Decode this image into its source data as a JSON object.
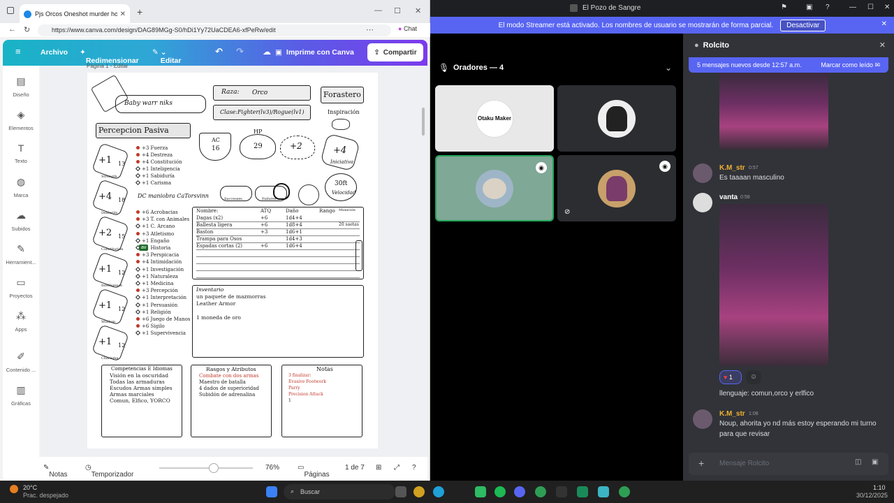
{
  "browser": {
    "tab_title": "Pjs Orcos Oneshot murder hobo ·",
    "url": "https://www.canva.com/design/DAG89MGg-S0/hDi1Yy72UaCDEA6-xfPeRw/edit",
    "chat_label": "Chat"
  },
  "canva": {
    "menu": {
      "archivo": "Archivo",
      "redimensionar": "Redimensionar",
      "editar": "Editar"
    },
    "print_label": "Imprime con Canva",
    "share_label": "Compartir",
    "page_header": "Página 1 - Editar",
    "sidebar": [
      {
        "label": "Diseño",
        "icon": "layout-icon"
      },
      {
        "label": "Elementos",
        "icon": "shapes-icon"
      },
      {
        "label": "Texto",
        "icon": "text-icon"
      },
      {
        "label": "Marca",
        "icon": "brand-icon"
      },
      {
        "label": "Subidos",
        "icon": "upload-icon"
      },
      {
        "label": "Herramient...",
        "icon": "tools-icon"
      },
      {
        "label": "Proyectos",
        "icon": "folder-icon"
      },
      {
        "label": "Apps",
        "icon": "apps-icon"
      },
      {
        "label": "Contenido ...",
        "icon": "content-icon"
      },
      {
        "label": "Gráficas",
        "icon": "chart-icon"
      }
    ],
    "bottom": {
      "notes": "Notas",
      "timer": "Temporizador",
      "zoom": "76%",
      "pages_label": "Páginas",
      "page_count": "1 de 7",
      "zoom_value": 76
    }
  },
  "sheet": {
    "name": "Baby warr niks",
    "race_label": "Raza:",
    "race": "Orco",
    "class": "Clase:Fighter(lv3)/Rogue(lv1)",
    "background": "Forastero",
    "inspiration": "Inspiración",
    "passive": "Percepcion Pasiva",
    "ac_label": "AC",
    "ac": "16",
    "hp_label": "HP",
    "hp": "29",
    "bonus": "+2",
    "initiative": "+4",
    "initiative_label": "Iniciativa",
    "speed": "30ft",
    "speed_label": "Velocidad",
    "dc_maneuver": "DC maniobra CaTorsvinn",
    "successes": "Successes",
    "failures": "Failures",
    "abilities": [
      {
        "mod": "+1",
        "score": "13",
        "name": "Strength"
      },
      {
        "mod": "+4",
        "score": "18",
        "name": "Dexterity"
      },
      {
        "mod": "+2",
        "score": "15",
        "name": "Constitution"
      },
      {
        "mod": "+1",
        "score": "12",
        "name": "Intelligence"
      },
      {
        "mod": "+1",
        "score": "12",
        "name": "Wisdom"
      },
      {
        "mod": "+1",
        "score": "12",
        "name": "Charisma"
      }
    ],
    "saves": [
      {
        "val": "+3",
        "name": "Fuerza"
      },
      {
        "val": "+4",
        "name": "Destreza"
      },
      {
        "val": "+4",
        "name": "Constitución"
      },
      {
        "val": "+1",
        "name": "Inteligencia"
      },
      {
        "val": "+1",
        "name": "Sabiduría"
      },
      {
        "val": "+1",
        "name": "Carisma"
      }
    ],
    "skills": [
      {
        "val": "+6",
        "name": "Acrobacias"
      },
      {
        "val": "+3",
        "name": "T. con Animales"
      },
      {
        "val": "+1",
        "name": "C. Arcano"
      },
      {
        "val": "+3",
        "name": "Atletismo"
      },
      {
        "val": "+1",
        "name": "Engaño"
      },
      {
        "val": "+1",
        "name": "Historia"
      },
      {
        "val": "+3",
        "name": "Perspicacia"
      },
      {
        "val": "+4",
        "name": "Intimidación"
      },
      {
        "val": "+1",
        "name": "Investigación"
      },
      {
        "val": "+1",
        "name": "Naturaleza"
      },
      {
        "val": "+1",
        "name": "Medicina"
      },
      {
        "val": "+3",
        "name": "Percepción"
      },
      {
        "val": "+1",
        "name": "Interpretación"
      },
      {
        "val": "+1",
        "name": "Persuasión"
      },
      {
        "val": "+1",
        "name": "Religión"
      },
      {
        "val": "+6",
        "name": "Juego de Manos"
      },
      {
        "val": "+6",
        "name": "Sigilo"
      },
      {
        "val": "+1",
        "name": "Supervivencia"
      }
    ],
    "av_badge": "av",
    "attacks_headers": [
      "Nombre:",
      "ATQ",
      "Daño",
      "Rango",
      "Munición"
    ],
    "attacks": [
      [
        "Dagas (x2)",
        "+6",
        "1d4+4",
        "",
        ""
      ],
      [
        "Ballesta ligera",
        "+6",
        "1d8+4",
        "",
        "20 saetas"
      ],
      [
        "Baston",
        "+3",
        "1d6+1",
        "",
        ""
      ],
      [
        "Trampa para Osos",
        "",
        "1d4+3",
        "",
        ""
      ],
      [
        "Espadas cortas (2)",
        "+6",
        "1d6+4",
        "",
        ""
      ]
    ],
    "inventory_title": "Inventario",
    "inventory": [
      "un paquete de mazmorras",
      "Leather Armor",
      "",
      "1 moneda de oro"
    ],
    "prof_title": "Competencias E Idiomas",
    "prof": [
      "Visión en la oscuridad",
      "Todas las armaduras",
      "Escudos   Armas simples",
      "Armas marciales",
      "Comun, Elfico, YORCO"
    ],
    "traits_title": "Rasgos y Atributos",
    "traits": [
      "Combate con dos armas",
      "Maestro de batalla",
      "4 dados de superioridad",
      "Subidón de adrenalina"
    ],
    "notes_title": "Notas",
    "notes": [
      "3 finalizar:",
      "Evasive Footwork",
      "Parry",
      "Precision Attack",
      "1"
    ]
  },
  "discord": {
    "app_title": "El Pozo de Sangre",
    "streamer_text": "El modo Streamer está activado. Los nombres de usuario se mostrarán de forma parcial.",
    "streamer_button": "Desactivar",
    "voice_header": "Oradores — 4",
    "tiles": [
      {
        "label": "Otaku Maker"
      },
      {
        "label": ""
      },
      {
        "label": ""
      },
      {
        "label": ""
      }
    ],
    "channel": "Rolcito",
    "new_messages": "5 mensajes nuevos desde 12:57 a.m.",
    "mark_read": "Marcar como leído",
    "messages": [
      {
        "author": "K.M_str",
        "time": "0:57",
        "text": "Es taaaan masculino",
        "color": "#f0b232"
      },
      {
        "author": "vanta",
        "time": "0:58",
        "text": "",
        "color": "#ffffff"
      },
      {
        "author": "",
        "time": "",
        "text": "llenguaje: comun,orco y erlfico",
        "color": "#ffffff"
      },
      {
        "author": "K.M_str",
        "time": "1:08",
        "text": "Noup, ahorita yo nd más estoy esperando mi turno para que revisar",
        "color": "#f0b232"
      }
    ],
    "reaction_count": "1",
    "input_placeholder": "Mensaje Rolcito"
  },
  "taskbar": {
    "temp": "20°C",
    "weather": "Prac. despejado",
    "search": "Buscar",
    "time": "1:10",
    "date": "30/12/2025"
  }
}
